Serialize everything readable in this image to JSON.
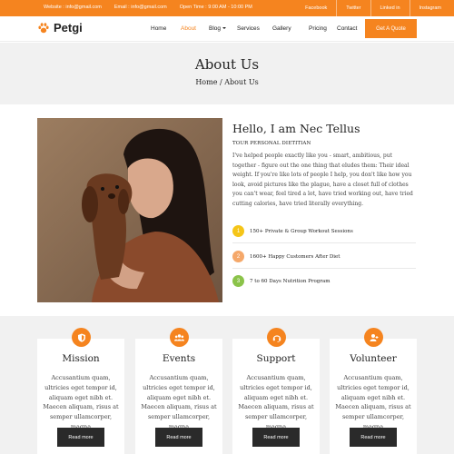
{
  "topbar": {
    "website_label": "Website :",
    "website_value": "info@gmail.com",
    "email_label": "Email :",
    "email_value": "info@gmail.com",
    "hours_label": "Open Time :",
    "hours_value": "9:00 AM - 10:00 PM",
    "social": [
      "Facebook",
      "Twitter",
      "Linked in",
      "Instagram"
    ]
  },
  "nav": {
    "logo": "Petgi",
    "items": [
      "Home",
      "About",
      "Blog",
      "Services",
      "Gallery",
      "Pricing",
      "Contact"
    ],
    "active": "About",
    "cta": "Get A Quote"
  },
  "hero": {
    "title": "About Us",
    "breadcrumb": "Home / About Us"
  },
  "about": {
    "title": "Hello, I am Nec Tellus",
    "subtitle": "TOUR PERSONAL DIETITIAN",
    "paragraph": "I've helped people exactly like you - smart, ambitious, put together - figure out the one thing that eludes them: Their ideal weight. If you're like lots of people I help, you don't like how you look, avoid pictures like the plague, have a closet full of clothes you can't wear, feel tired a lot, have tried working out, have tried cutting calories, have tried literally everything.",
    "features": [
      {
        "num": "1",
        "label": "150+ Private & Group Workout Sessions",
        "color": "#f5c518"
      },
      {
        "num": "2",
        "label": "1600+ Happy Customers After Diet",
        "color": "#f5a86a"
      },
      {
        "num": "3",
        "label": "7 to 60 Days Nutrition Program",
        "color": "#8bc34a"
      }
    ]
  },
  "services": [
    {
      "title": "Mission",
      "icon": "shield-icon",
      "text": "Accusantium quam, ultricies eget tempor id, aliquam eget nibh et. Maecen aliquam, risus at semper ullamcorper, magna",
      "button": "Read more"
    },
    {
      "title": "Events",
      "icon": "people-icon",
      "text": "Accusantium quam, ultricies eget tempor id, aliquam eget nibh et. Maecen aliquam, risus at semper ullamcorper, magna",
      "button": "Read more"
    },
    {
      "title": "Support",
      "icon": "headset-icon",
      "text": "Accusantium quam, ultricies eget tempor id, aliquam eget nibh et. Maecen aliquam, risus at semper ullamcorper, magna",
      "button": "Read more"
    },
    {
      "title": "Volunteer",
      "icon": "user-plus-icon",
      "text": "Accusantium quam, ultricies eget tempor id, aliquam eget nibh et. Maecen aliquam, risus at semper ullamcorper, magna",
      "button": "Read more"
    }
  ],
  "colors": {
    "accent": "#f5841f",
    "dark_button": "#2a2a2a",
    "section_bg": "#f1f1f1"
  }
}
